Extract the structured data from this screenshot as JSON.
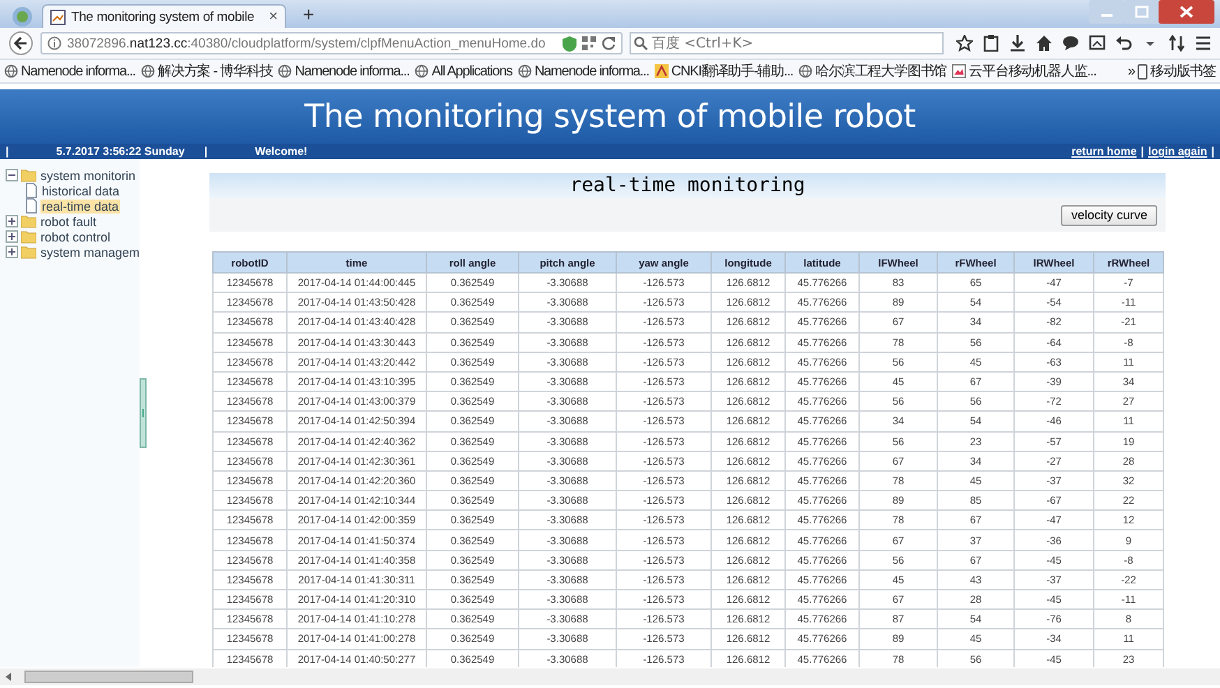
{
  "browser": {
    "tab_title": "The monitoring system of mobile",
    "tab_close": "×",
    "new_tab": "+",
    "url": "38072896.**nat123.cc**:40380/cloudplatform/system/clpfMenuAction_menuHome.do",
    "search_placeholder": "百度 <Ctrl+K>",
    "bookmarks": [
      {
        "kind": "globe",
        "label": "Namenode informa..."
      },
      {
        "kind": "globe",
        "label": "解决方案 - 博华科技"
      },
      {
        "kind": "globe",
        "label": "Namenode informa..."
      },
      {
        "kind": "globe",
        "label": "All Applications"
      },
      {
        "kind": "globe",
        "label": "Namenode informa..."
      },
      {
        "kind": "cnki",
        "label": "CNKI翻译助手-辅助..."
      },
      {
        "kind": "globe",
        "label": "哈尔滨工程大学图书馆"
      },
      {
        "kind": "page",
        "label": "云平台移动机器人监..."
      }
    ],
    "bookmarks_more": "»",
    "mobile_bookmarks": "移动版书签"
  },
  "header": {
    "title": "The monitoring system of mobile robot"
  },
  "status_bar": {
    "left": [
      {
        "kind": "separator",
        "text": "|"
      },
      {
        "kind": "text",
        "text": "5.7.2017 3:56:22 Sunday"
      },
      {
        "kind": "separator",
        "text": "|"
      },
      {
        "kind": "text",
        "text": "Welcome!"
      }
    ],
    "right": [
      {
        "kind": "link",
        "text": "return home"
      },
      {
        "kind": "separator",
        "text": "|"
      },
      {
        "kind": "link",
        "text": "login again"
      },
      {
        "kind": "separator",
        "text": "|"
      }
    ]
  },
  "sidebar": {
    "items": [
      {
        "label": "system monitorin",
        "expanded": true,
        "children": [
          {
            "label": "historical data",
            "selected": false
          },
          {
            "label": "real-time data",
            "selected": true
          }
        ]
      },
      {
        "label": "robot fault",
        "expanded": false
      },
      {
        "label": "robot control",
        "expanded": false
      },
      {
        "label": "system managem",
        "expanded": false
      }
    ]
  },
  "panel": {
    "title": "real-time monitoring",
    "button": "velocity curve"
  },
  "table": {
    "columns": [
      "robotID",
      "time",
      "roll angle",
      "pitch angle",
      "yaw angle",
      "longitude",
      "latitude",
      "lFWheel",
      "rFWheel",
      "lRWheel",
      "rRWheel"
    ],
    "rows": [
      [
        "12345678",
        "2017-04-14 01:44:00:445",
        "0.362549",
        "-3.30688",
        "-126.573",
        "126.6812",
        "45.776266",
        "83",
        "65",
        "-47",
        "-7"
      ],
      [
        "12345678",
        "2017-04-14 01:43:50:428",
        "0.362549",
        "-3.30688",
        "-126.573",
        "126.6812",
        "45.776266",
        "89",
        "54",
        "-54",
        "-11"
      ],
      [
        "12345678",
        "2017-04-14 01:43:40:428",
        "0.362549",
        "-3.30688",
        "-126.573",
        "126.6812",
        "45.776266",
        "67",
        "34",
        "-82",
        "-21"
      ],
      [
        "12345678",
        "2017-04-14 01:43:30:443",
        "0.362549",
        "-3.30688",
        "-126.573",
        "126.6812",
        "45.776266",
        "78",
        "56",
        "-64",
        "-8"
      ],
      [
        "12345678",
        "2017-04-14 01:43:20:442",
        "0.362549",
        "-3.30688",
        "-126.573",
        "126.6812",
        "45.776266",
        "56",
        "45",
        "-63",
        "11"
      ],
      [
        "12345678",
        "2017-04-14 01:43:10:395",
        "0.362549",
        "-3.30688",
        "-126.573",
        "126.6812",
        "45.776266",
        "45",
        "67",
        "-39",
        "34"
      ],
      [
        "12345678",
        "2017-04-14 01:43:00:379",
        "0.362549",
        "-3.30688",
        "-126.573",
        "126.6812",
        "45.776266",
        "56",
        "56",
        "-72",
        "27"
      ],
      [
        "12345678",
        "2017-04-14 01:42:50:394",
        "0.362549",
        "-3.30688",
        "-126.573",
        "126.6812",
        "45.776266",
        "34",
        "54",
        "-46",
        "11"
      ],
      [
        "12345678",
        "2017-04-14 01:42:40:362",
        "0.362549",
        "-3.30688",
        "-126.573",
        "126.6812",
        "45.776266",
        "56",
        "23",
        "-57",
        "19"
      ],
      [
        "12345678",
        "2017-04-14 01:42:30:361",
        "0.362549",
        "-3.30688",
        "-126.573",
        "126.6812",
        "45.776266",
        "67",
        "34",
        "-27",
        "28"
      ],
      [
        "12345678",
        "2017-04-14 01:42:20:360",
        "0.362549",
        "-3.30688",
        "-126.573",
        "126.6812",
        "45.776266",
        "78",
        "45",
        "-37",
        "32"
      ],
      [
        "12345678",
        "2017-04-14 01:42:10:344",
        "0.362549",
        "-3.30688",
        "-126.573",
        "126.6812",
        "45.776266",
        "89",
        "85",
        "-67",
        "22"
      ],
      [
        "12345678",
        "2017-04-14 01:42:00:359",
        "0.362549",
        "-3.30688",
        "-126.573",
        "126.6812",
        "45.776266",
        "78",
        "67",
        "-47",
        "12"
      ],
      [
        "12345678",
        "2017-04-14 01:41:50:374",
        "0.362549",
        "-3.30688",
        "-126.573",
        "126.6812",
        "45.776266",
        "67",
        "37",
        "-36",
        "9"
      ],
      [
        "12345678",
        "2017-04-14 01:41:40:358",
        "0.362549",
        "-3.30688",
        "-126.573",
        "126.6812",
        "45.776266",
        "56",
        "67",
        "-45",
        "-8"
      ],
      [
        "12345678",
        "2017-04-14 01:41:30:311",
        "0.362549",
        "-3.30688",
        "-126.573",
        "126.6812",
        "45.776266",
        "45",
        "43",
        "-37",
        "-22"
      ],
      [
        "12345678",
        "2017-04-14 01:41:20:310",
        "0.362549",
        "-3.30688",
        "-126.573",
        "126.6812",
        "45.776266",
        "67",
        "28",
        "-45",
        "-11"
      ],
      [
        "12345678",
        "2017-04-14 01:41:10:278",
        "0.362549",
        "-3.30688",
        "-126.573",
        "126.6812",
        "45.776266",
        "87",
        "54",
        "-76",
        "8"
      ],
      [
        "12345678",
        "2017-04-14 01:41:00:278",
        "0.362549",
        "-3.30688",
        "-126.573",
        "126.6812",
        "45.776266",
        "89",
        "45",
        "-34",
        "11"
      ],
      [
        "12345678",
        "2017-04-14 01:40:50:277",
        "0.362549",
        "-3.30688",
        "-126.573",
        "126.6812",
        "45.776266",
        "78",
        "56",
        "-45",
        "23"
      ]
    ]
  }
}
